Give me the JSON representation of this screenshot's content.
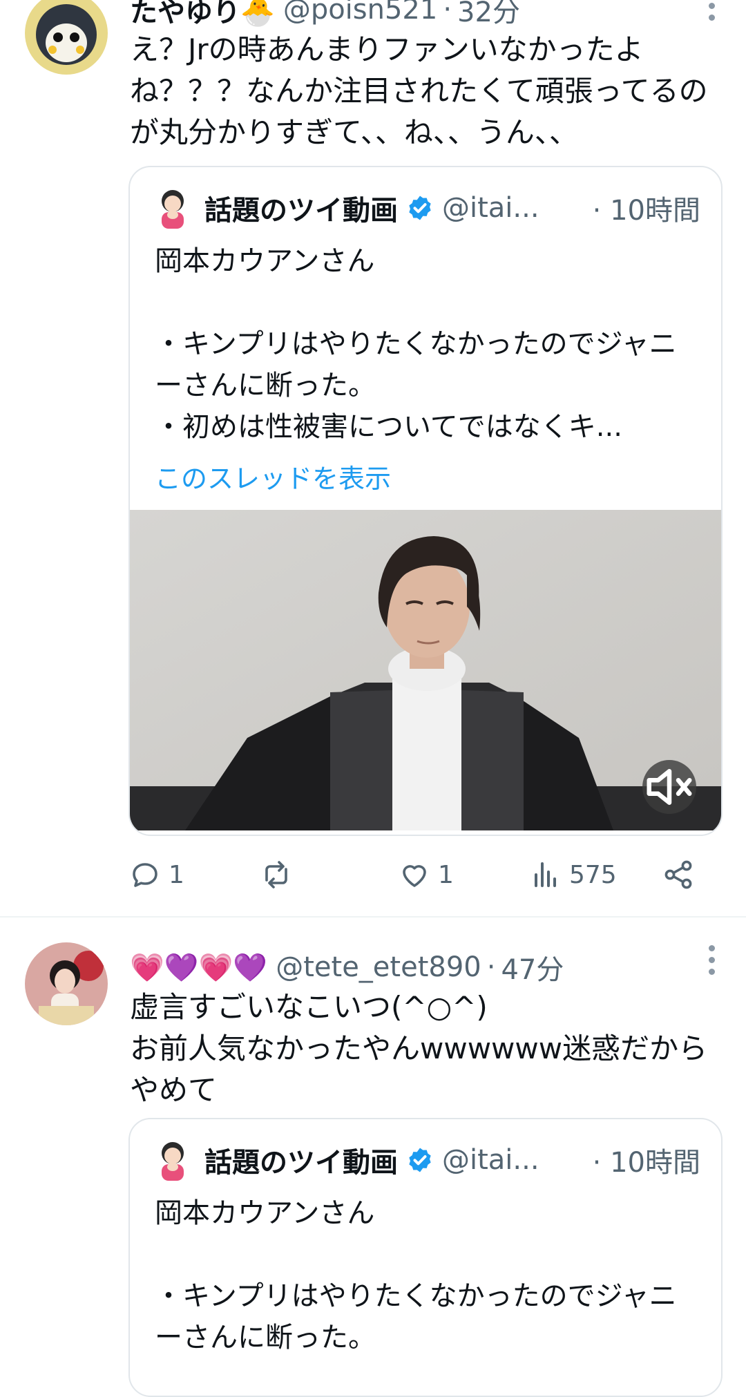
{
  "tweets": [
    {
      "name": "たやゆり🐣",
      "handle": "@poisn521",
      "dot": "·",
      "time": "32分",
      "text": "え？Jrの時あんまりファンいなかったよね？？？なんか注目されたくて頑張ってるのが丸分かりすぎて、、ね、、うん、、",
      "quote": {
        "name": "話題のツイ動画",
        "handle": "@itai...",
        "time": "· 10時間",
        "body": "岡本カウアンさん\n\n・キンプリはやりたくなかったのでジャニーさんに断った。\n・初めは性被害についてではなくキ...",
        "thread_link": "このスレッドを表示"
      },
      "actions": {
        "replies": "1",
        "retweets": "",
        "likes": "1",
        "views": "575"
      }
    },
    {
      "name": "💗💜💗💜",
      "handle": "@tete_etet890",
      "dot": "·",
      "time": "47分",
      "text": "虚言すごいなこいつ(^○^)\nお前人気なかったやんwwwwww迷惑だからやめて",
      "quote": {
        "name": "話題のツイ動画",
        "handle": "@itai...",
        "time": "· 10時間",
        "body": "岡本カウアンさん\n\n・キンプリはやりたくなかったのでジャニーさんに断った。"
      }
    }
  ],
  "colors": {
    "accent": "#1d9bf0",
    "secondary": "#536471",
    "border": "#e1e6ea"
  },
  "icons": [
    "more-icon",
    "verified-badge-icon",
    "mute-icon",
    "reply-icon",
    "retweet-icon",
    "like-icon",
    "views-icon",
    "share-icon"
  ]
}
